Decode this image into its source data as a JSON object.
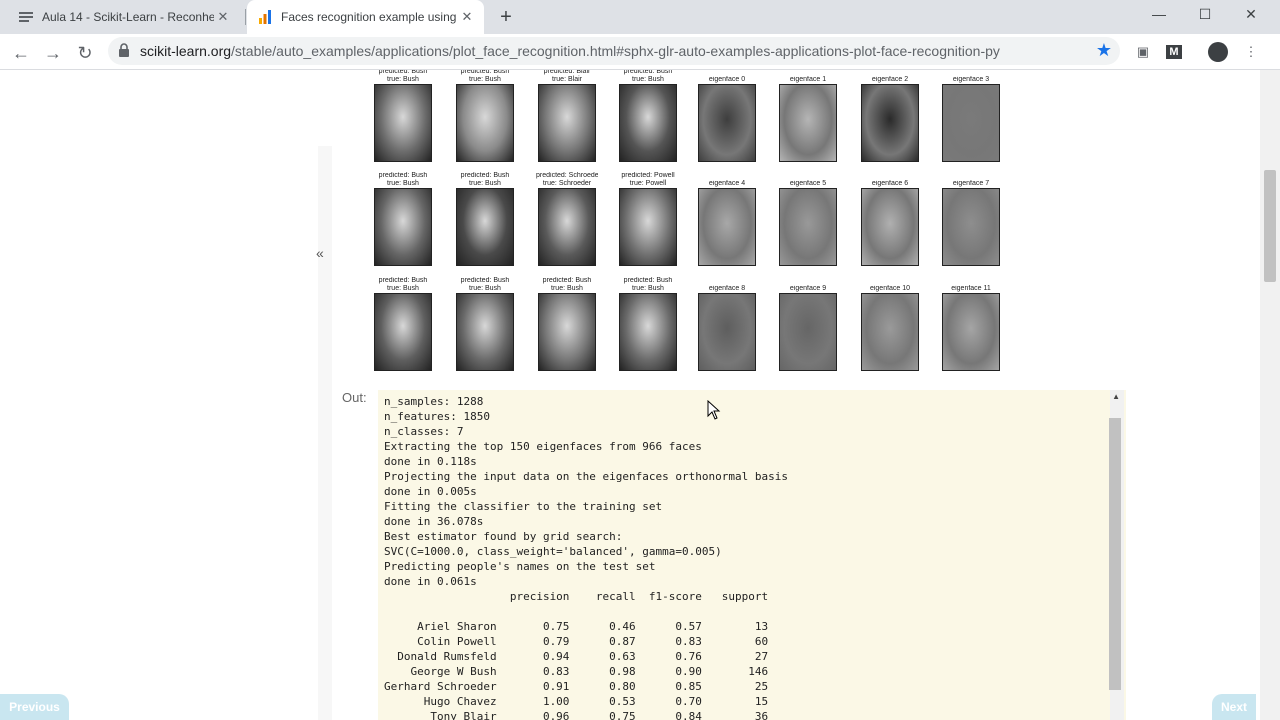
{
  "browser": {
    "tabs": [
      {
        "title": "Aula 14 - Scikit-Learn - Reconhec",
        "active": false
      },
      {
        "title": "Faces recognition example using",
        "active": true
      }
    ],
    "url_host": "scikit-learn.org",
    "url_path": "/stable/auto_examples/applications/plot_face_recognition.html#sphx-glr-auto-examples-applications-plot-face-recognition-py",
    "accent_color": "#1a73e8"
  },
  "figure": {
    "rows": [
      [
        {
          "pred": "predicted: Bush",
          "true": "true:     Bush",
          "shade": "#6e6e6e"
        },
        {
          "pred": "predicted: Bush",
          "true": "true:     Bush",
          "shade": "#8a8a8a"
        },
        {
          "pred": "predicted: Blair",
          "true": "true:     Blair",
          "shade": "#777"
        },
        {
          "pred": "predicted: Bush",
          "true": "true:     Bush",
          "shade": "#555"
        }
      ],
      [
        {
          "pred": "predicted: Bush",
          "true": "true:     Bush",
          "shade": "#666"
        },
        {
          "pred": "predicted: Bush",
          "true": "true:     Bush",
          "shade": "#4a4a4a"
        },
        {
          "pred": "predicted: Schroeder",
          "true": "true:   Schroeder",
          "shade": "#5a5a5a"
        },
        {
          "pred": "predicted: Powell",
          "true": "true:    Powell",
          "shade": "#707070"
        }
      ],
      [
        {
          "pred": "predicted: Bush",
          "true": "true:     Bush",
          "shade": "#5f5f5f"
        },
        {
          "pred": "predicted: Bush",
          "true": "true:     Bush",
          "shade": "#6a6a6a"
        },
        {
          "pred": "predicted: Bush",
          "true": "true:     Bush",
          "shade": "#777"
        },
        {
          "pred": "predicted: Bush",
          "true": "true:     Bush",
          "shade": "#6b6b6b"
        }
      ]
    ],
    "eigenfaces": [
      {
        "label": "eigenface 0",
        "shade": "#3e3e3e"
      },
      {
        "label": "eigenface 1",
        "shade": "#b5b5b5"
      },
      {
        "label": "eigenface 2",
        "shade": "#2a2a2a"
      },
      {
        "label": "eigenface 3",
        "shade": "#7a7a7a"
      },
      {
        "label": "eigenface 4",
        "shade": "#a8a8a8"
      },
      {
        "label": "eigenface 5",
        "shade": "#999"
      },
      {
        "label": "eigenface 6",
        "shade": "#b0b0b0"
      },
      {
        "label": "eigenface 7",
        "shade": "#8e8e8e"
      },
      {
        "label": "eigenface 8",
        "shade": "#5e5e5e"
      },
      {
        "label": "eigenface 9",
        "shade": "#666"
      },
      {
        "label": "eigenface 10",
        "shade": "#9a9a9a"
      },
      {
        "label": "eigenface 11",
        "shade": "#a5a5a5"
      }
    ]
  },
  "output": {
    "label": "Out:",
    "text": "n_samples: 1288\nn_features: 1850\nn_classes: 7\nExtracting the top 150 eigenfaces from 966 faces\ndone in 0.118s\nProjecting the input data on the eigenfaces orthonormal basis\ndone in 0.005s\nFitting the classifier to the training set\ndone in 36.078s\nBest estimator found by grid search:\nSVC(C=1000.0, class_weight='balanced', gamma=0.005)\nPredicting people's names on the test set\ndone in 0.061s\n                   precision    recall  f1-score   support\n\n     Ariel Sharon       0.75      0.46      0.57        13\n     Colin Powell       0.79      0.87      0.83        60\n  Donald Rumsfeld       0.94      0.63      0.76        27\n    George W Bush       0.83      0.98      0.90       146\nGerhard Schroeder       0.91      0.80      0.85        25\n      Hugo Chavez       1.00      0.53      0.70        15\n       Tony Blair       0.96      0.75      0.84        36"
  },
  "pager": {
    "previous": "Previous",
    "next": "Next"
  },
  "sidebar": {
    "collapse_label": "«"
  }
}
